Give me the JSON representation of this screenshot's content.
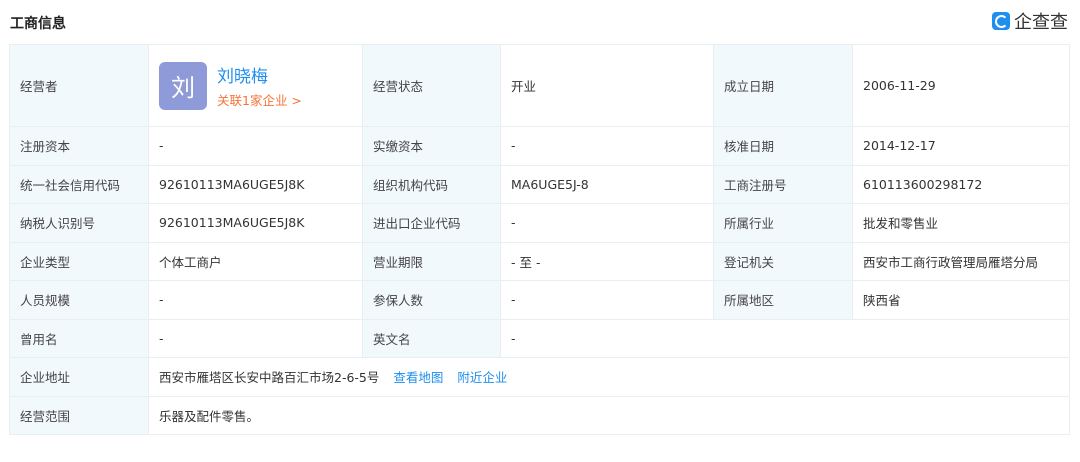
{
  "header": {
    "title": "工商信息",
    "logo_text": "企查查"
  },
  "person": {
    "avatar": "刘",
    "name": "刘晓梅",
    "related": "关联1家企业 >"
  },
  "rows": [
    {
      "l1": "经营者",
      "l2": "经营状态",
      "v2": "开业",
      "l3": "成立日期",
      "v3": "2006-11-29"
    },
    {
      "l1": "注册资本",
      "v1": "-",
      "l2": "实缴资本",
      "v2": "-",
      "l3": "核准日期",
      "v3": "2014-12-17"
    },
    {
      "l1": "统一社会信用代码",
      "v1": "92610113MA6UGE5J8K",
      "l2": "组织机构代码",
      "v2": "MA6UGE5J-8",
      "l3": "工商注册号",
      "v3": "610113600298172"
    },
    {
      "l1": "纳税人识别号",
      "v1": "92610113MA6UGE5J8K",
      "l2": "进出口企业代码",
      "v2": "-",
      "l3": "所属行业",
      "v3": "批发和零售业"
    },
    {
      "l1": "企业类型",
      "v1": "个体工商户",
      "l2": "营业期限",
      "v2": "- 至 -",
      "l3": "登记机关",
      "v3": "西安市工商行政管理局雁塔分局"
    },
    {
      "l1": "人员规模",
      "v1": "-",
      "l2": "参保人数",
      "v2": "-",
      "l3": "所属地区",
      "v3": "陕西省"
    },
    {
      "l1": "曾用名",
      "v1": "-",
      "l2": "英文名",
      "v2": "-"
    }
  ],
  "address": {
    "label": "企业地址",
    "value": "西安市雁塔区长安中路百汇市场2-6-5号",
    "map_link": "查看地图",
    "nearby_link": "附近企业"
  },
  "scope": {
    "label": "经营范围",
    "value": "乐器及配件零售。"
  }
}
